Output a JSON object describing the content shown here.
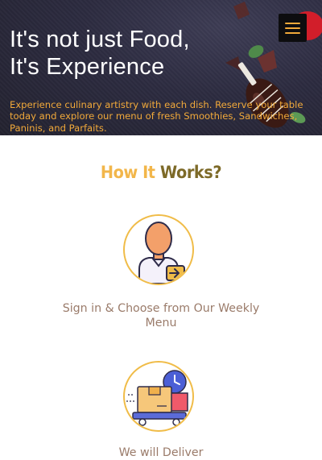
{
  "hero": {
    "title_line1": "It's not just Food,",
    "title_line2": "It's Experience",
    "subtitle": "Experience culinary artistry with each dish. Reserve your table today and explore our menu of fresh Smoothies, Sandwiches, Paninis, and Parfaits."
  },
  "menu": {
    "icon": "hamburger-menu-icon"
  },
  "how_it_works": {
    "title_part1": "How It",
    "title_part2": "Works?",
    "steps": [
      {
        "label": "Sign in & Choose from Our Weekly Menu",
        "icon": "user-signin-icon"
      },
      {
        "label": "We will Deliver",
        "icon": "delivery-icon"
      }
    ]
  },
  "colors": {
    "accent_orange": "#f1a93a",
    "title_gold": "#f2b64a",
    "title_olive": "#7d6a28",
    "step_text": "#9a7b6a",
    "hero_bg": "#2c2b40"
  }
}
